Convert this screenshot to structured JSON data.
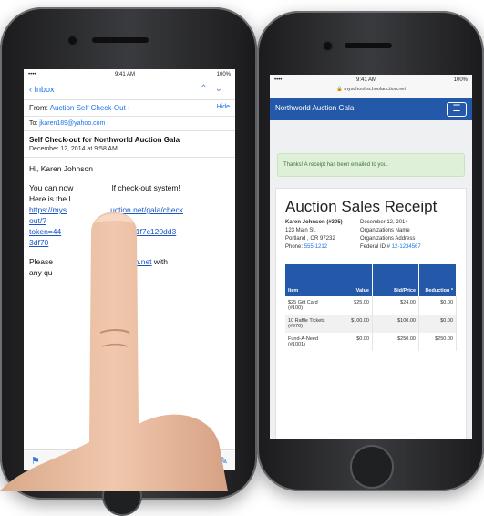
{
  "left_phone": {
    "status": {
      "carrier": "•••• ",
      "time": "9:41 AM",
      "battery": "100%"
    },
    "nav": {
      "back_label": "Inbox"
    },
    "from": {
      "prefix": "From:",
      "name": "Auction Self Check-Out",
      "hide_label": "Hide"
    },
    "to": {
      "prefix": "To:",
      "address": "jkaren189@yahoo.com"
    },
    "subject": "Self Check-out for Northworld Auction Gala",
    "date": "December 12, 2014 at 9:58 AM",
    "greeting": "Hi, Karen Johnson",
    "para1_start": "You can now",
    "para1_end": "lf check-out system!",
    "para1_line2": "Here is the l",
    "link_parts": [
      "https://mys",
      "uction.net/gala/check",
      "out/?",
      "token=44",
      "9a13f0efcc1f7c120dd3",
      "3df70"
    ],
    "para2_start": "Please",
    "para2_link": "schoolauction.net",
    "para2_end": " with",
    "para2_line2": "any qu"
  },
  "right_phone": {
    "status": {
      "carrier": "•••• ",
      "time": "9:41 AM",
      "battery": "100%"
    },
    "url": "myschool.schoolauction.net",
    "nav_title": "Northworld Auction Gala",
    "alert": "Thanks! A receipt has been emailed to you.",
    "receipt_title": "Auction Sales Receipt",
    "buyer": {
      "name": "Karen Johnson (#305)",
      "street": "123 Main St.",
      "city": "Portland , OR 97232",
      "phone_label": "Phone:",
      "phone": "555-1212"
    },
    "org": {
      "date": "December 12, 2014",
      "name": "Organizations Name",
      "address": "Organizations Address",
      "fed_label": "Federal ID #",
      "fed_id": "12-1234567"
    },
    "table": {
      "headers": [
        "Item",
        "Value",
        "Bid/Price",
        "Deduction *"
      ],
      "rows": [
        [
          "$25 Gift Card (#100)",
          "$25.00",
          "$24.00",
          "$0.00"
        ],
        [
          "10 Raffle Tickets (#976)",
          "$100.00",
          "$100.00",
          "$0.00"
        ],
        [
          "Fund-A-Need (#1001)",
          "$0.00",
          "$250.00",
          "$250.00"
        ]
      ]
    }
  }
}
